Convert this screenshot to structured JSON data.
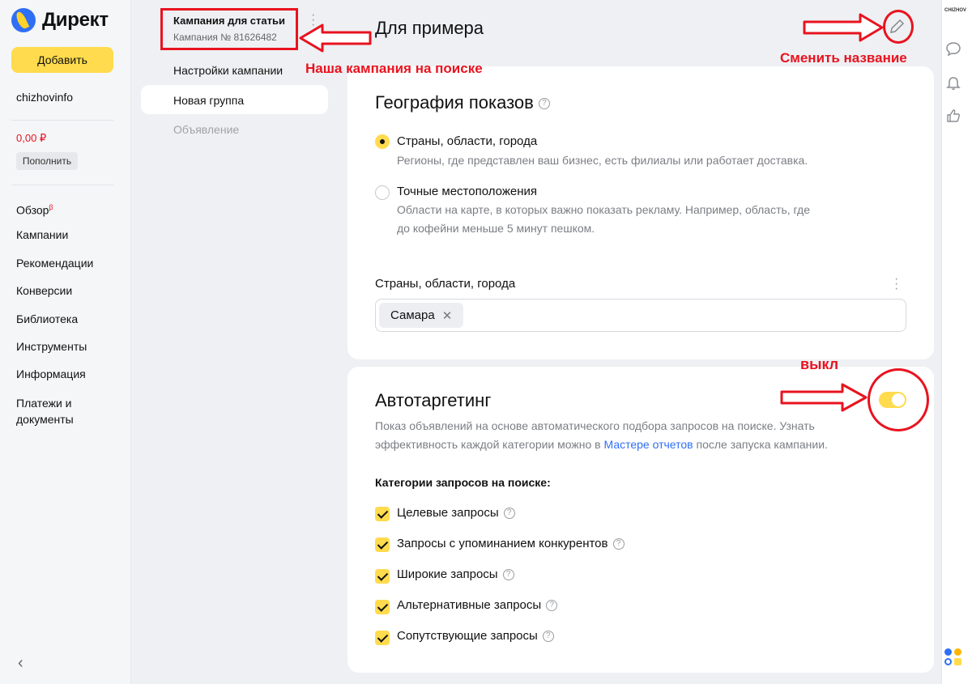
{
  "sidebar": {
    "logo_text": "Директ",
    "add_button": "Добавить",
    "user": "chizhovinfo",
    "balance": "0,00 ₽",
    "topup_button": "Пополнить",
    "nav": [
      {
        "label": "Обзор",
        "sup": "β"
      },
      {
        "label": "Кампании"
      },
      {
        "label": "Рекомендации"
      },
      {
        "label": "Конверсии"
      },
      {
        "label": "Библиотека"
      },
      {
        "label": "Инструменты"
      },
      {
        "label": "Информация"
      },
      {
        "label": "Платежи и документы"
      }
    ],
    "collapse_icon": "chevron-left-icon"
  },
  "subnav": {
    "campaign_title": "Кампания для статьи",
    "campaign_id": "Кампания № 81626482",
    "items": [
      "Настройки кампании",
      "Новая группа",
      "Объявление"
    ]
  },
  "header": {
    "title": "Для примера"
  },
  "geo": {
    "title": "География показов",
    "options": [
      {
        "label": "Страны, области, города",
        "desc": "Регионы, где представлен ваш бизнес, есть филиалы или работает доставка.",
        "selected": true
      },
      {
        "label": "Точные местоположения",
        "desc_line1": "Области на карте, в которых важно показать рекламу. Например, область, где",
        "desc_line2": "до кофейни меньше 5 минут пешком.",
        "selected": false
      }
    ],
    "field_label": "Страны, области, города",
    "chip": "Самара"
  },
  "autotarget": {
    "title": "Автотаргетинг",
    "desc_before_link": "Показ объявлений на основе автоматического подбора запросов на поиске. Узнать эффективность каждой категории можно в ",
    "link": "Мастере отчетов",
    "desc_after_link": " после запуска кампании.",
    "categories_head": "Категории запросов на поиске:",
    "categories": [
      "Целевые запросы",
      "Запросы с упоминанием конкурентов",
      "Широкие запросы",
      "Альтернативные запросы",
      "Сопутствующие запросы"
    ],
    "toggle_on": true
  },
  "rail": {
    "avatar_text": "CHIZHOV"
  },
  "annotations": {
    "campaign": "Наша кампания на поиске",
    "rename": "Сменить название",
    "off": "выкл"
  },
  "colors": {
    "accent": "#ffdb4d",
    "annotation": "#e8131f",
    "link": "#2f6ff6"
  }
}
